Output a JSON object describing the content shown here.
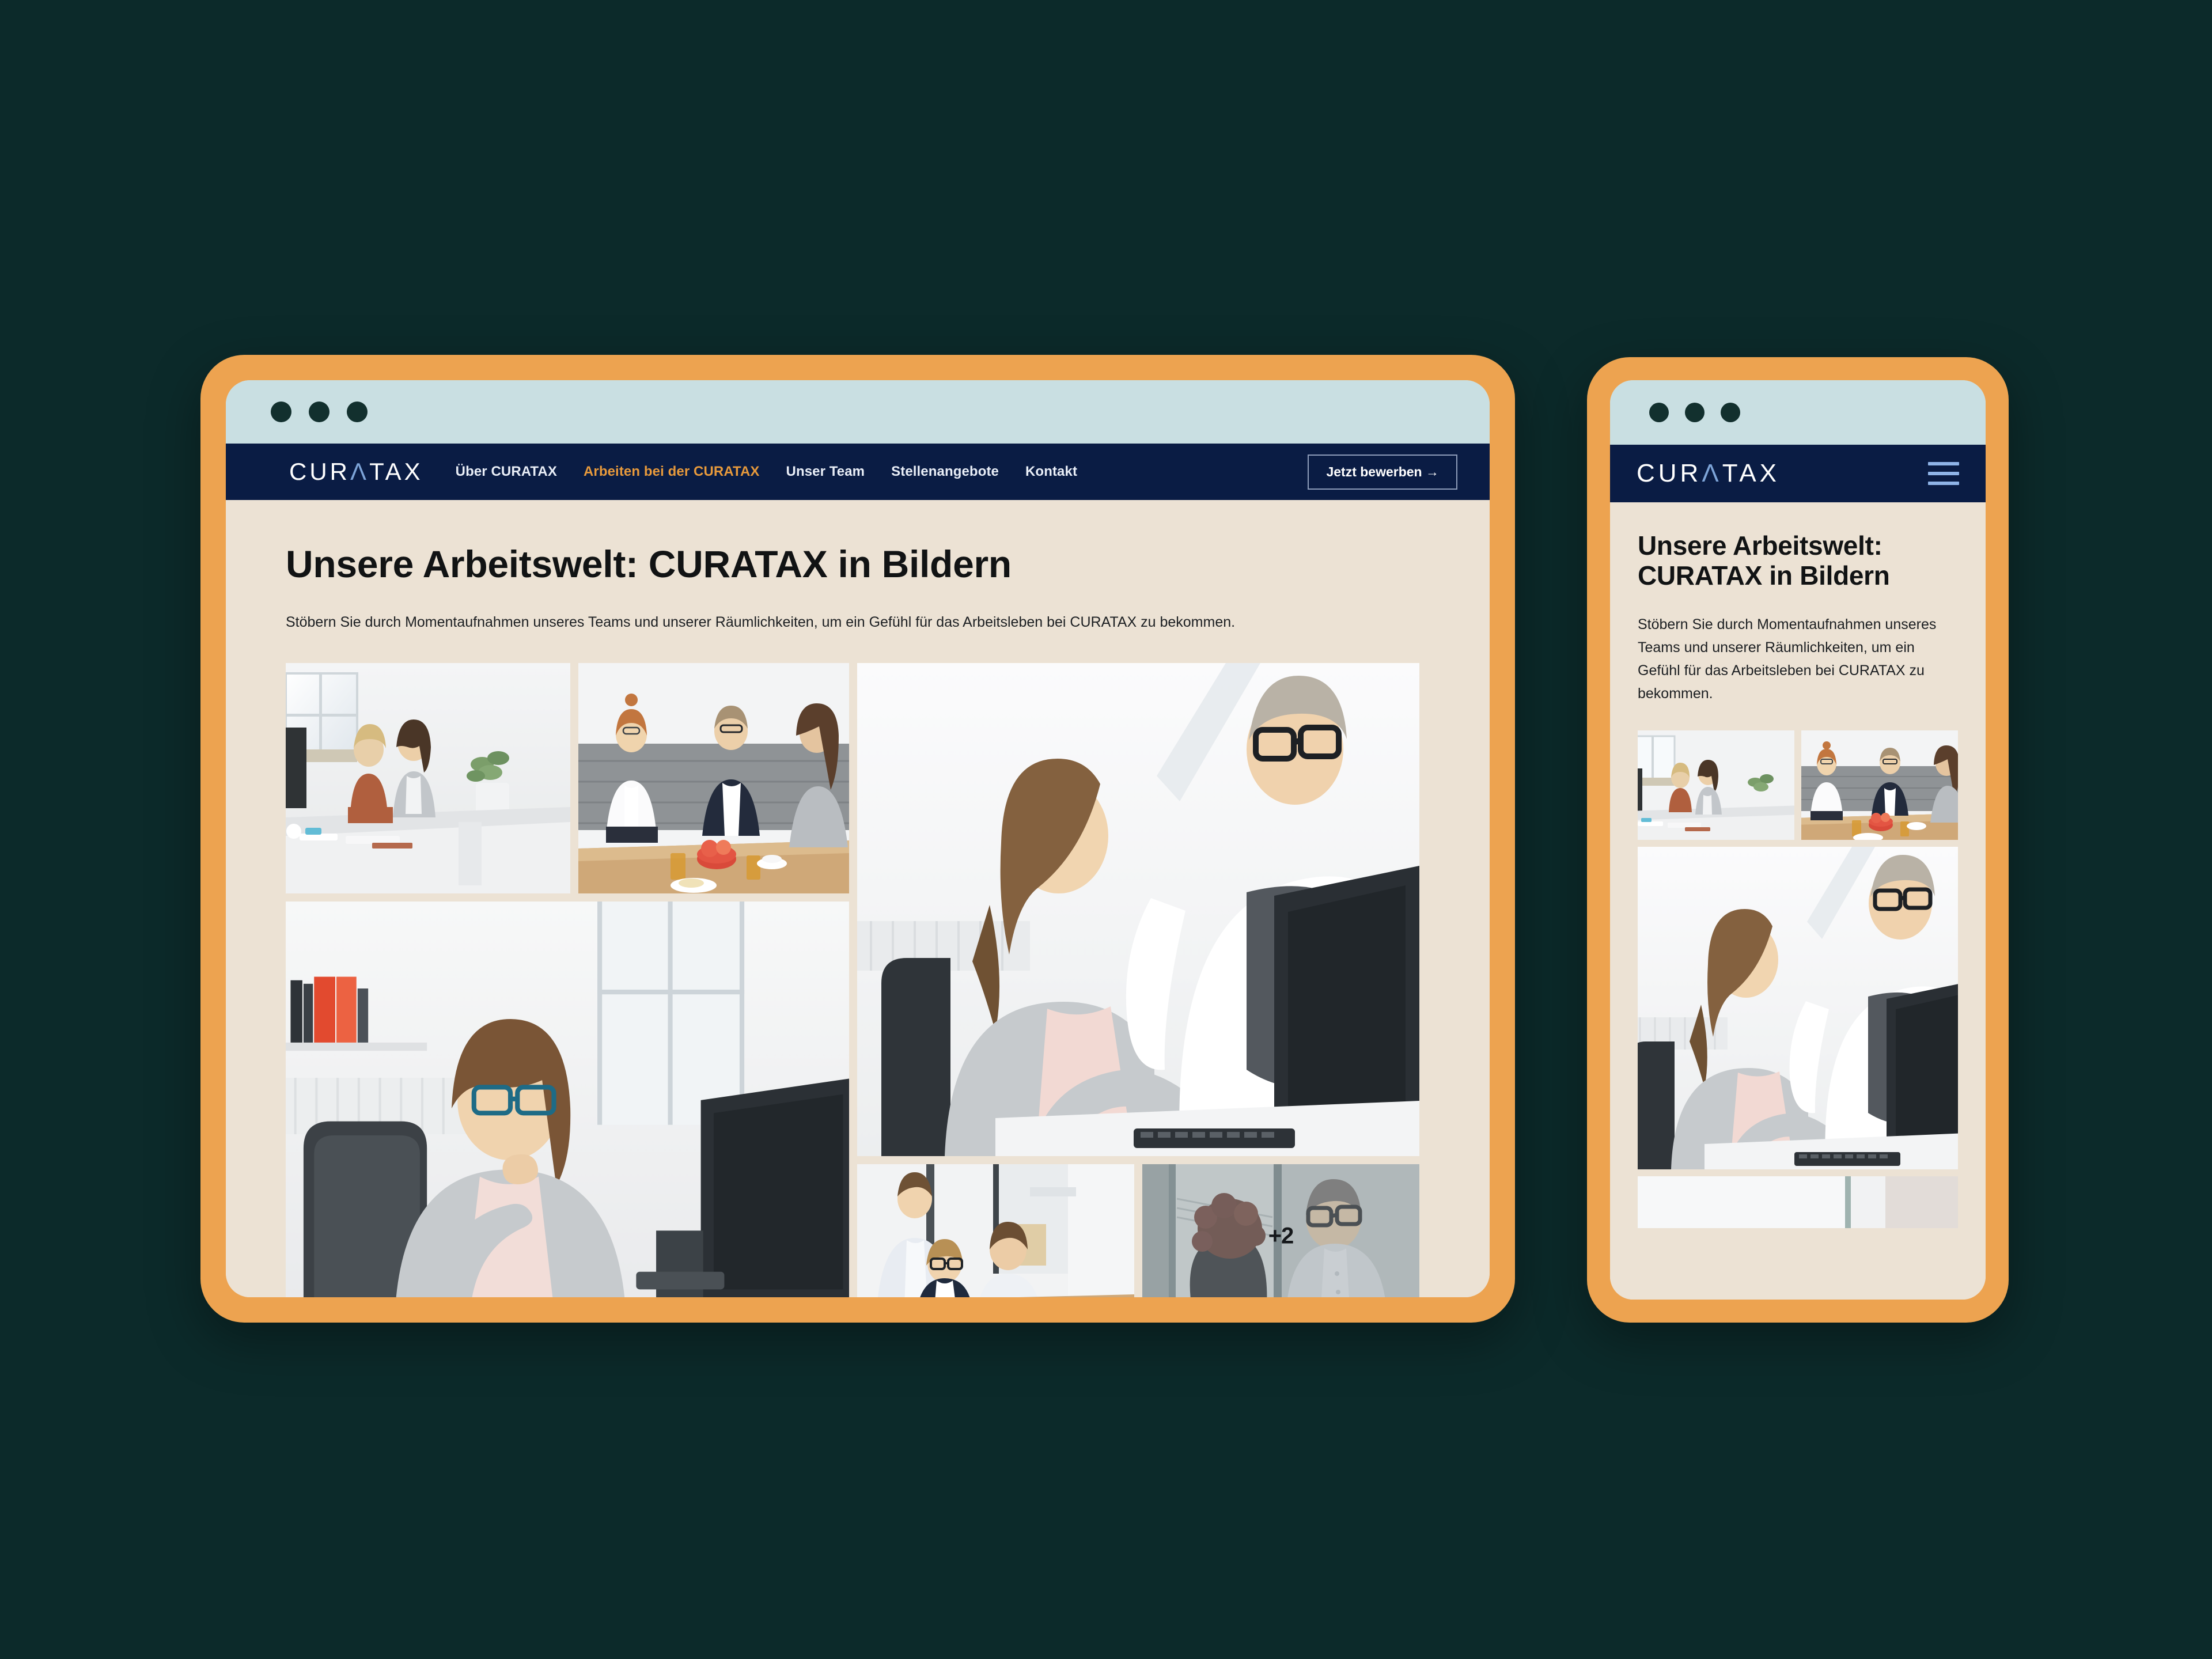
{
  "background_color": "#0c2a2a",
  "frame_color": "#eda350",
  "titlebar_color": "#c9dfe2",
  "navbar_color": "#0a1c44",
  "page_bg_color": "#ece2d4",
  "accent_color": "#e89a3c",
  "desktop": {
    "titlebar": {
      "dots": [
        "dot-red",
        "dot-yellow",
        "dot-green"
      ]
    },
    "brand": {
      "prefix": "CUR",
      "mark": "Λ",
      "suffix": "TAX"
    },
    "nav": [
      {
        "label": "Über CURATAX",
        "active": false
      },
      {
        "label": "Arbeiten bei der CURATAX",
        "active": true
      },
      {
        "label": "Unser Team",
        "active": false
      },
      {
        "label": "Stellenangebote",
        "active": false
      },
      {
        "label": "Kontakt",
        "active": false
      }
    ],
    "cta": {
      "label": "Jetzt bewerben →"
    },
    "page": {
      "title": "Unsere Arbeitswelt: CURATAX in Bildern",
      "subtitle": "Stöbern Sie durch Momentaufnahmen unseres Teams und unserer Räumlichkeiten, um ein Gefühl für das Arbeitsleben bei CURATAX zu bekommen."
    },
    "gallery": {
      "more_badge": "+2",
      "photos": [
        {
          "id": "photo-two-women-desk",
          "alt": "Zwei Kolleginnen an einem Bürotisch am Fenster"
        },
        {
          "id": "photo-team-lunch",
          "alt": "Team beim gemeinsamen Mittagessen mit Obstschale"
        },
        {
          "id": "photo-woman-glasses-desk",
          "alt": "Lächelnde Mitarbeiterin mit Brille am Schreibtisch"
        },
        {
          "id": "photo-colleagues-monitor",
          "alt": "Kollege zeigt Kollegin etwas am Bildschirm"
        },
        {
          "id": "photo-three-colleagues",
          "alt": "Drei Kollegen besprechen Unterlagen"
        },
        {
          "id": "photo-hallway-chat",
          "alt": "Zwei Kollegen im Gespräch im Flur"
        }
      ]
    }
  },
  "mobile": {
    "titlebar": {
      "dots": [
        "dot-red",
        "dot-yellow",
        "dot-green"
      ]
    },
    "brand": {
      "prefix": "CUR",
      "mark": "Λ",
      "suffix": "TAX"
    },
    "menu_icon": "hamburger-icon",
    "page": {
      "title": "Unsere Arbeitswelt: CURATAX in Bildern",
      "subtitle": "Stöbern Sie durch Momentaufnahmen unseres Teams und unserer Räumlichkeiten, um ein Gefühl für das Arbeitsleben bei CURATAX zu bekommen."
    },
    "gallery": {
      "photos": [
        {
          "id": "photo-two-women-desk",
          "alt": "Zwei Kolleginnen an einem Bürotisch am Fenster"
        },
        {
          "id": "photo-team-lunch",
          "alt": "Team beim gemeinsamen Mittagessen mit Obstschale"
        },
        {
          "id": "photo-colleagues-monitor",
          "alt": "Kollege zeigt Kollegin etwas am Bildschirm"
        },
        {
          "id": "photo-partial-bottom",
          "alt": "Angeschnittenes Bürofoto am unteren Rand"
        }
      ]
    }
  }
}
